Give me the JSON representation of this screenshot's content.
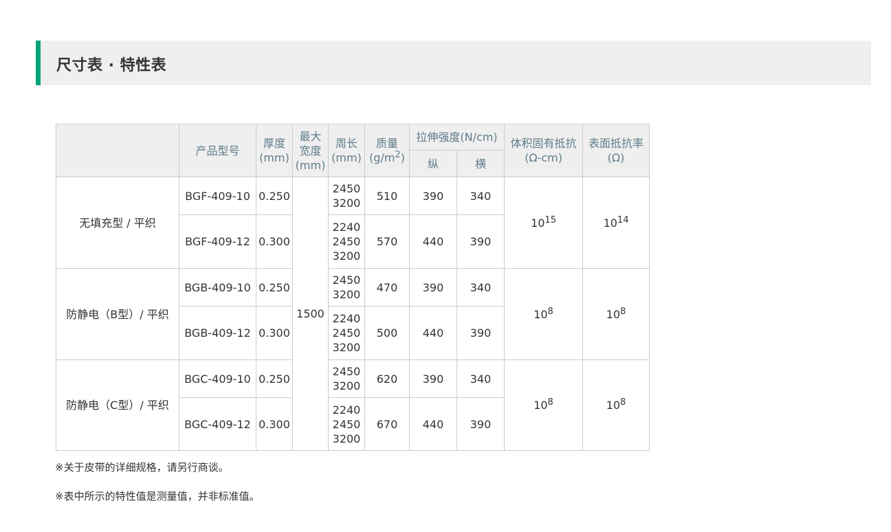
{
  "section": {
    "title": "尺寸表 · 特性表"
  },
  "table": {
    "headers": {
      "model": "产品型号",
      "thickness": [
        "厚度",
        "(mm)"
      ],
      "max_width": [
        "最大",
        "宽度",
        "(mm)"
      ],
      "circumference": [
        "周长",
        "(mm)"
      ],
      "mass": [
        "质量",
        "(g/m",
        "2",
        ")"
      ],
      "tensile": "拉伸强度(N/cm)",
      "tensile_long": "纵",
      "tensile_trans": "横",
      "volume_resistivity": [
        "体积固有抵抗",
        "(Ω-cm)"
      ],
      "surface_resistivity": [
        "表面抵抗率",
        "(Ω)"
      ]
    },
    "max_width_value": "1500",
    "groups": [
      {
        "category": "无填充型 / 平织",
        "volume_res": {
          "base": "10",
          "exp": "15"
        },
        "surface_res": {
          "base": "10",
          "exp": "14"
        },
        "rows": [
          {
            "model": "BGF-409-10",
            "thickness": "0.250",
            "circ": [
              "2450",
              "3200"
            ],
            "mass": "510",
            "long": "390",
            "trans": "340"
          },
          {
            "model": "BGF-409-12",
            "thickness": "0.300",
            "circ": [
              "2240",
              "2450",
              "3200"
            ],
            "mass": "570",
            "long": "440",
            "trans": "390"
          }
        ]
      },
      {
        "category": "防静电（B型）/ 平织",
        "volume_res": {
          "base": "10",
          "exp": "8"
        },
        "surface_res": {
          "base": "10",
          "exp": "8"
        },
        "rows": [
          {
            "model": "BGB-409-10",
            "thickness": "0.250",
            "circ": [
              "2450",
              "3200"
            ],
            "mass": "470",
            "long": "390",
            "trans": "340"
          },
          {
            "model": "BGB-409-12",
            "thickness": "0.300",
            "circ": [
              "2240",
              "2450",
              "3200"
            ],
            "mass": "500",
            "long": "440",
            "trans": "390"
          }
        ]
      },
      {
        "category": "防静电（C型）/ 平织",
        "volume_res": {
          "base": "10",
          "exp": "8"
        },
        "surface_res": {
          "base": "10",
          "exp": "8"
        },
        "rows": [
          {
            "model": "BGC-409-10",
            "thickness": "0.250",
            "circ": [
              "2450",
              "3200"
            ],
            "mass": "620",
            "long": "390",
            "trans": "340"
          },
          {
            "model": "BGC-409-12",
            "thickness": "0.300",
            "circ": [
              "2240",
              "2450",
              "3200"
            ],
            "mass": "670",
            "long": "440",
            "trans": "390"
          }
        ]
      }
    ]
  },
  "notes": [
    "※关于皮带的详细规格，请另行商谈。",
    "※表中所示的特性值是测量值，并非标准值。"
  ]
}
